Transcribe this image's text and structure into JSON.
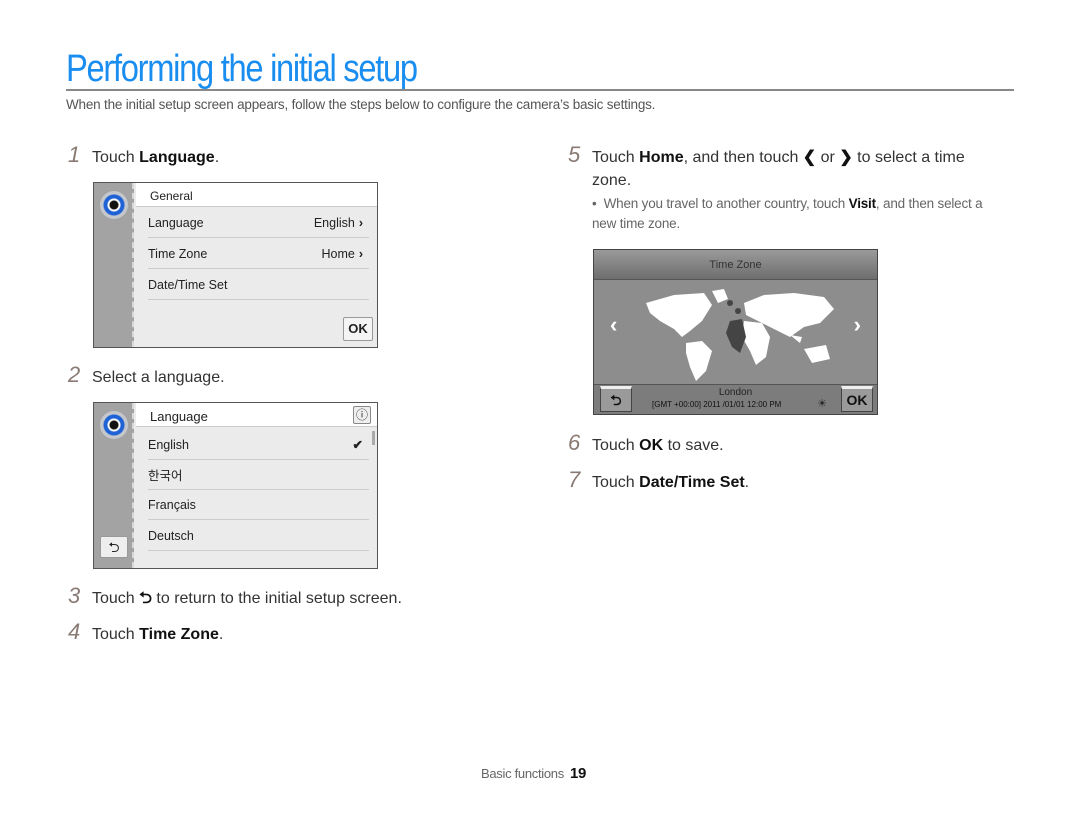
{
  "title": "Performing the initial setup",
  "intro": "When the initial setup screen appears, follow the steps below to configure the camera’s basic settings.",
  "steps": [
    {
      "num": "1",
      "pre": "Touch ",
      "bold": "Language",
      "post": "."
    },
    {
      "num": "2",
      "pre": "Select a language.",
      "bold": "",
      "post": ""
    },
    {
      "num": "3",
      "pre": "Touch ",
      "icon": "back-arrow",
      "post": " to return to the initial setup screen."
    },
    {
      "num": "4",
      "pre": "Touch ",
      "bold": "Time Zone",
      "post": "."
    },
    {
      "num": "5",
      "pre": "Touch ",
      "bold": "Home",
      "mid": ", and then touch ",
      "or": " or ",
      "post": " to select a time",
      "post2": "zone."
    },
    {
      "num": "6",
      "pre": "Touch ",
      "bold": "OK",
      "post": " to save."
    },
    {
      "num": "7",
      "pre": "Touch ",
      "bold": "Date/Time Set",
      "post": "."
    }
  ],
  "step5_bullet": {
    "pre": "When you travel to another country, touch ",
    "bold": "Visit",
    "post": ", and then select a new time zone."
  },
  "screen_general": {
    "header": "General",
    "rows": [
      {
        "label": "Language",
        "value": "English"
      },
      {
        "label": "Time Zone",
        "value": "Home"
      },
      {
        "label": "Date/Time Set",
        "value": ""
      }
    ],
    "ok": "OK"
  },
  "screen_language": {
    "header": "Language",
    "info": "ⓘ",
    "items": [
      "English",
      "한국어",
      "Français",
      "Deutsch"
    ],
    "selected": "English",
    "back": "⮌"
  },
  "screen_timezone": {
    "header": "Time Zone",
    "city": "London",
    "gmt": "[GMT +00:00] 2011 /01/01 12:00 PM",
    "ok": "OK",
    "back": "⮌",
    "prev": "‹",
    "next": "›"
  },
  "footer": {
    "section": "Basic functions",
    "page": "19"
  },
  "colors": {
    "title": "#1a8df0",
    "step_number": "#8a7a74"
  }
}
